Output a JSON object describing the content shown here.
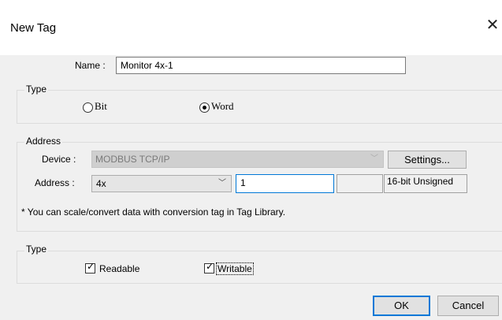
{
  "window": {
    "title": "New Tag"
  },
  "name": {
    "label": "Name :",
    "value": "Monitor 4x-1"
  },
  "type_group": {
    "title": "Type",
    "options": [
      {
        "label": "Bit",
        "selected": false
      },
      {
        "label": "Word",
        "selected": true
      }
    ]
  },
  "address_group": {
    "title": "Address",
    "device_label": "Device :",
    "device_value": "MODBUS TCP/IP",
    "settings_label": "Settings...",
    "address_label": "Address :",
    "address_type": "4x",
    "address_value": "1",
    "data_format": "16-bit Unsigned",
    "note": "* You can scale/convert data with conversion tag in Tag Library."
  },
  "access_group": {
    "title": "Type",
    "readable": {
      "label": "Readable",
      "checked": true
    },
    "writable": {
      "label": "Writable",
      "checked": true
    }
  },
  "buttons": {
    "ok": "OK",
    "cancel": "Cancel"
  },
  "colors": {
    "accent": "#0078d7",
    "dialog_bg": "#f0f0f0",
    "title_bg": "#ffffff"
  }
}
